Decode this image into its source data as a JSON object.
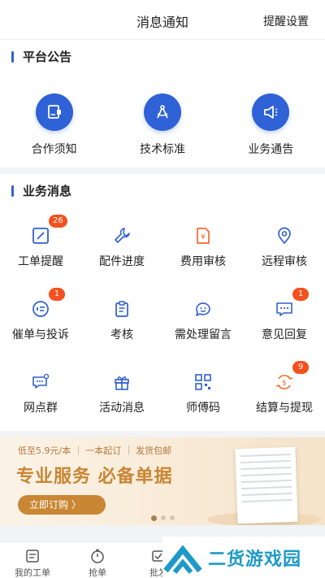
{
  "header": {
    "title": "消息通知",
    "settings_label": "提醒设置"
  },
  "platform": {
    "heading": "平台公告",
    "items": [
      {
        "label": "合作须知",
        "icon": "contract-icon"
      },
      {
        "label": "技术标准",
        "icon": "compass-icon"
      },
      {
        "label": "业务通告",
        "icon": "megaphone-icon"
      }
    ]
  },
  "business": {
    "heading": "业务消息",
    "items": [
      {
        "label": "工单提醒",
        "icon": "edit-icon",
        "badge": "26"
      },
      {
        "label": "配件进度",
        "icon": "wrench-icon",
        "badge": ""
      },
      {
        "label": "费用审核",
        "icon": "fee-document-icon",
        "badge": ""
      },
      {
        "label": "远程审核",
        "icon": "location-pin-icon",
        "badge": ""
      },
      {
        "label": "催单与投诉",
        "icon": "urge-complaint-icon",
        "badge": "1"
      },
      {
        "label": "考核",
        "icon": "clipboard-icon",
        "badge": ""
      },
      {
        "label": "需处理留言",
        "icon": "message-smile-icon",
        "badge": ""
      },
      {
        "label": "意见回复",
        "icon": "feedback-chat-icon",
        "badge": "1"
      },
      {
        "label": "网点群",
        "icon": "group-chat-icon",
        "badge": ""
      },
      {
        "label": "活动消息",
        "icon": "gift-icon",
        "badge": ""
      },
      {
        "label": "师傅码",
        "icon": "qr-code-icon",
        "badge": ""
      },
      {
        "label": "结算与提现",
        "icon": "settlement-icon",
        "badge": "9"
      }
    ]
  },
  "banner": {
    "promo_text": "低至5.9元/本 ｜ 一本起订 ｜ 发货包邮",
    "headline": "专业服务 必备单据",
    "cta_label": "立即订购 〉"
  },
  "tabbar": {
    "items": [
      {
        "label": "我的工单",
        "icon": "work-order-icon"
      },
      {
        "label": "抢单",
        "icon": "timer-icon"
      },
      {
        "label": "批发",
        "icon": "wholesale-icon"
      }
    ]
  },
  "watermark": {
    "text": "二货游戏园"
  },
  "colors": {
    "accent": "#2f62d6",
    "icon_blue": "#2f5fd0",
    "icon_orange": "#ef6a2c",
    "badge": "#f4511e",
    "banner_gold": "#c98633"
  }
}
